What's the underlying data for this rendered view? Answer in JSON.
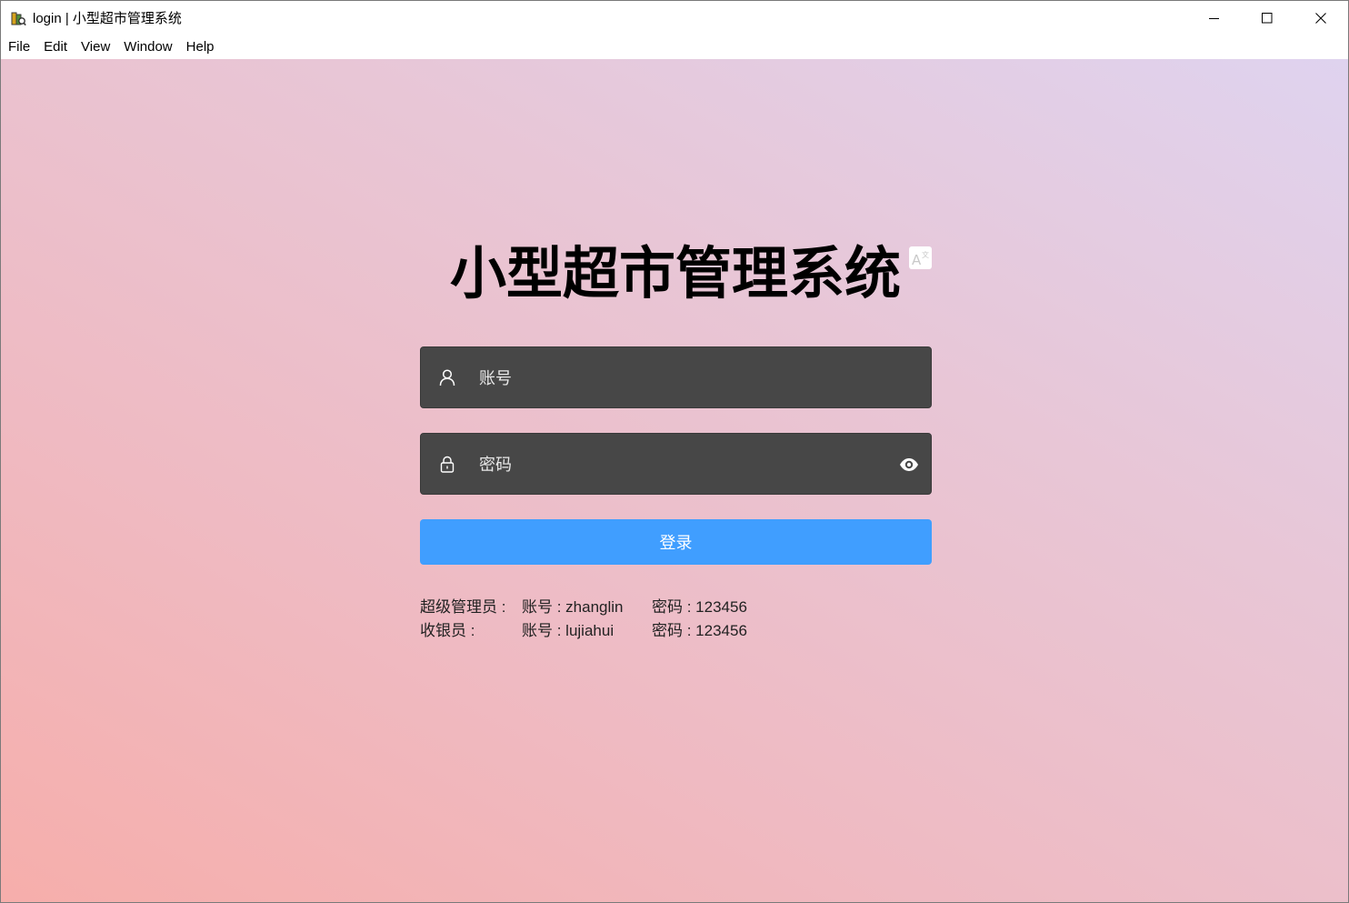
{
  "window": {
    "title": "login | 小型超市管理系统",
    "menu": [
      "File",
      "Edit",
      "View",
      "Window",
      "Help"
    ]
  },
  "login": {
    "heading": "小型超市管理系统",
    "username_placeholder": "账号",
    "password_placeholder": "密码",
    "submit_label": "登录"
  },
  "hints": [
    {
      "role": "超级管理员 :",
      "account": "账号 : zhanglin",
      "password": "密码 : 123456"
    },
    {
      "role": "收银员 :",
      "account": "账号 : lujiahui",
      "password": "密码 : 123456"
    }
  ],
  "icons": {
    "username": "user-icon",
    "password": "lock-icon",
    "reveal": "eye-icon",
    "language": "translate-icon"
  },
  "colors": {
    "primary_button": "#409eff",
    "input_background": "#474747",
    "gradient": [
      "#f6aeab",
      "#efbac2",
      "#e8c6d6",
      "#dfd3ef"
    ]
  }
}
